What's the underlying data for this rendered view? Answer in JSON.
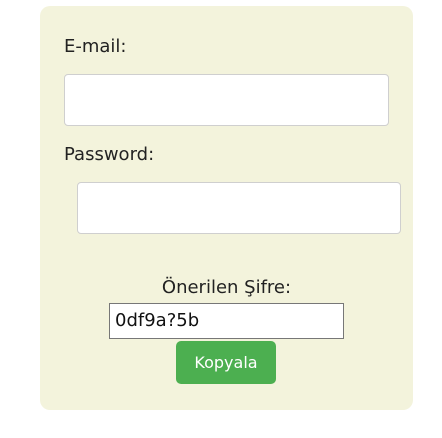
{
  "form": {
    "email_label": "E-mail:",
    "email_value": "",
    "password_label": "Password:",
    "password_value": "",
    "suggested_label": "Önerilen Şifre:",
    "suggested_value": "0df9a?5b",
    "copy_button_label": "Kopyala"
  },
  "colors": {
    "card_background": "#f3f3dc",
    "button_background": "#4caf50",
    "button_text": "#ffffff"
  }
}
